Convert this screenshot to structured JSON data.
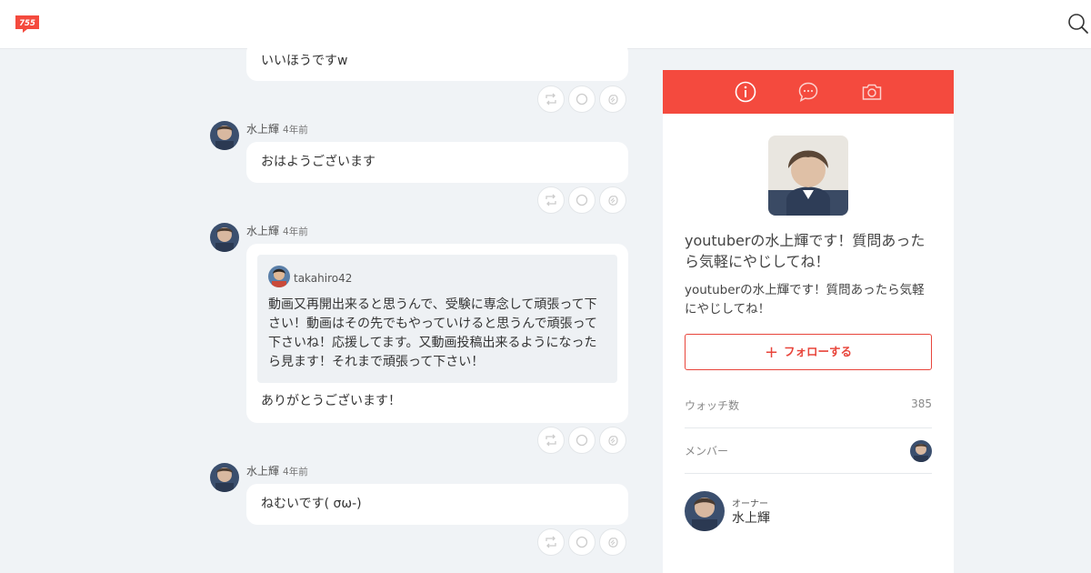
{
  "header": {
    "logo_text": "755",
    "logo_icon": "755-logo-icon",
    "search_icon": "search-icon"
  },
  "messages": [
    {
      "text": "いいほうですw",
      "actions": [
        "retweet-icon",
        "comment-icon",
        "clap-icon"
      ]
    },
    {
      "name": "水上輝",
      "time": "4年前",
      "text": "おはようございます",
      "actions": [
        "retweet-icon",
        "comment-icon",
        "clap-icon"
      ]
    },
    {
      "name": "水上輝",
      "time": "4年前",
      "quote": {
        "name": "takahiro42",
        "text": "動画又再開出来ると思うんで、受験に専念して頑張って下さい！動画はその先でもやっていけると思うんで頑張って下さいね！応援してます。又動画投稿出来るようになったら見ます！それまで頑張って下さい！"
      },
      "text": "ありがとうございます！",
      "actions": [
        "retweet-icon",
        "comment-icon",
        "clap-icon"
      ]
    },
    {
      "name": "水上輝",
      "time": "4年前",
      "text": "ねむいです( σω-)",
      "actions": [
        "retweet-icon",
        "comment-icon",
        "clap-icon"
      ]
    }
  ],
  "sidebar": {
    "tabs": [
      "info-icon",
      "chat-icon",
      "camera-icon"
    ],
    "title": "youtuberの水上輝です！質問あったら気軽にやじしてね！",
    "description": "youtuberの水上輝です！質問あったら気軽にやじしてね！",
    "follow_label": "フォローする",
    "watch_label": "ウォッチ数",
    "watch_count": "385",
    "member_label": "メンバー",
    "owner_role": "オーナー",
    "owner_name": "水上輝"
  },
  "colors": {
    "brand": "#f44a3e",
    "background": "#f0f3f6"
  }
}
